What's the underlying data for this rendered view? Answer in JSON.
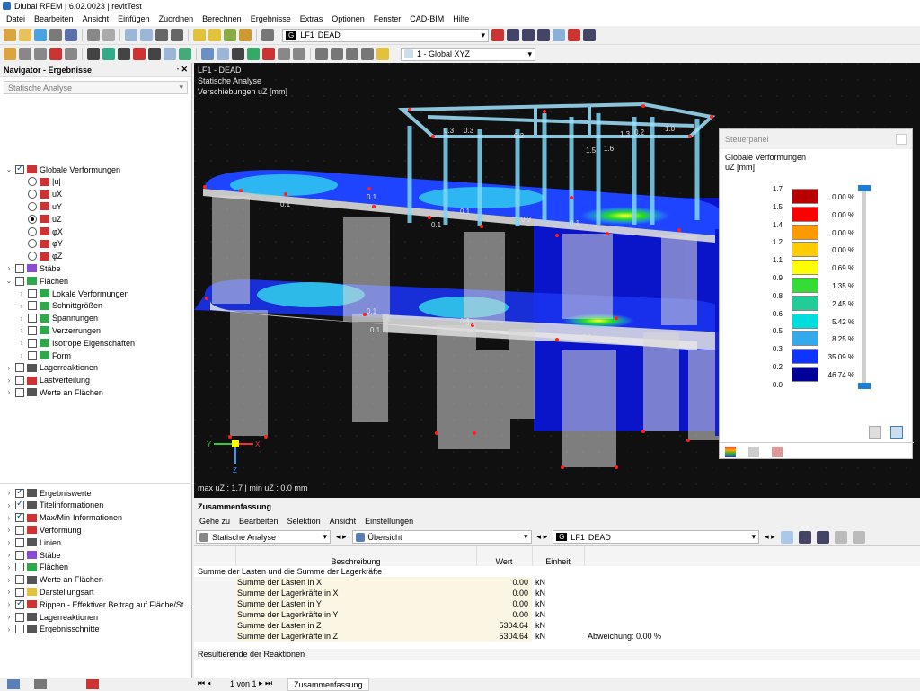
{
  "app": {
    "title": "Dlubal RFEM | 6.02.0023 | revitTest"
  },
  "menu": [
    "Datei",
    "Bearbeiten",
    "Ansicht",
    "Einfügen",
    "Zuordnen",
    "Berechnen",
    "Ergebnisse",
    "Extras",
    "Optionen",
    "Fenster",
    "CAD-BIM",
    "Hilfe"
  ],
  "toolbar": {
    "lc_g": "G",
    "lc_id": "LF1",
    "lc_name": "DEAD",
    "coord_system": "1 - Global XYZ"
  },
  "navigator": {
    "title": "Navigator - Ergebnisse",
    "analysis_select": "Statische Analyse",
    "top_items": [
      {
        "type": "check",
        "on": true,
        "expanded": true,
        "label": "Globale Verformungen",
        "icon": "deformation-icon",
        "level": 0
      },
      {
        "type": "radio",
        "on": false,
        "label": "|u|",
        "icon": "deformation-icon",
        "level": 1
      },
      {
        "type": "radio",
        "on": false,
        "label": "uX",
        "icon": "deformation-icon",
        "level": 1
      },
      {
        "type": "radio",
        "on": false,
        "label": "uY",
        "icon": "deformation-icon",
        "level": 1
      },
      {
        "type": "radio",
        "on": true,
        "label": "uZ",
        "icon": "deformation-icon",
        "level": 1
      },
      {
        "type": "radio",
        "on": false,
        "label": "φX",
        "icon": "deformation-icon",
        "level": 1
      },
      {
        "type": "radio",
        "on": false,
        "label": "φY",
        "icon": "deformation-icon",
        "level": 1
      },
      {
        "type": "radio",
        "on": false,
        "label": "φZ",
        "icon": "deformation-icon",
        "level": 1
      },
      {
        "type": "check",
        "on": false,
        "expanded": false,
        "label": "Stäbe",
        "icon": "member-icon",
        "level": 0
      },
      {
        "type": "check",
        "on": false,
        "expanded": true,
        "label": "Flächen",
        "icon": "surface-icon",
        "level": 0
      },
      {
        "type": "check",
        "on": false,
        "expanded": false,
        "label": "Lokale Verformungen",
        "icon": "surface-icon",
        "level": 1
      },
      {
        "type": "check",
        "on": false,
        "expanded": false,
        "label": "Schnittgrößen",
        "icon": "surface-icon",
        "level": 1
      },
      {
        "type": "check",
        "on": false,
        "expanded": false,
        "label": "Spannungen",
        "icon": "surface-icon",
        "level": 1
      },
      {
        "type": "check",
        "on": false,
        "expanded": false,
        "label": "Verzerrungen",
        "icon": "surface-icon",
        "level": 1
      },
      {
        "type": "check",
        "on": false,
        "expanded": false,
        "label": "Isotrope Eigenschaften",
        "icon": "surface-icon",
        "level": 1
      },
      {
        "type": "check",
        "on": false,
        "expanded": false,
        "label": "Form",
        "icon": "surface-icon",
        "level": 1
      },
      {
        "type": "check",
        "on": false,
        "expanded": false,
        "label": "Lagerreaktionen",
        "icon": "support-icon",
        "level": 0
      },
      {
        "type": "check",
        "on": false,
        "expanded": false,
        "label": "Lastverteilung",
        "icon": "load-icon",
        "level": 0
      },
      {
        "type": "check",
        "on": false,
        "expanded": false,
        "label": "Werte an Flächen",
        "icon": "values-icon",
        "level": 0
      }
    ],
    "bottom_items": [
      {
        "on": true,
        "label": "Ergebniswerte",
        "icon": "values-icon"
      },
      {
        "on": true,
        "label": "Titelinformationen",
        "icon": "title-icon"
      },
      {
        "on": true,
        "label": "Max/Min-Informationen",
        "icon": "maxmin-icon"
      },
      {
        "on": false,
        "label": "Verformung",
        "icon": "deformation-icon"
      },
      {
        "on": false,
        "label": "Linien",
        "icon": "line-icon"
      },
      {
        "on": false,
        "label": "Stäbe",
        "icon": "member-icon"
      },
      {
        "on": false,
        "label": "Flächen",
        "icon": "surface-icon"
      },
      {
        "on": false,
        "label": "Werte an Flächen",
        "icon": "values-icon"
      },
      {
        "on": false,
        "label": "Darstellungsart",
        "icon": "display-icon"
      },
      {
        "on": true,
        "label": "Rippen - Effektiver Beitrag auf Fläche/St...",
        "icon": "rib-icon"
      },
      {
        "on": false,
        "label": "Lagerreaktionen",
        "icon": "support-icon"
      },
      {
        "on": false,
        "label": "Ergebnisschnitte",
        "icon": "section-icon"
      }
    ]
  },
  "view": {
    "line1": "LF1 - DEAD",
    "line2": "Statische Analyse",
    "line3": "Verschiebungen uZ [mm]",
    "footer": "max uZ : 1.7 | min uZ : 0.0 mm",
    "labels": [
      "0.1",
      "0.1",
      "0.1",
      "0.1",
      "0.1",
      "0.3",
      "0.1",
      "0.1",
      "0.1",
      "0.1",
      "0.3",
      "0.3",
      "0.2",
      "0.2",
      "1.5",
      "1.6",
      "1.3",
      "1.0",
      "0.1"
    ],
    "axes": {
      "x": "X",
      "y": "Y",
      "z": "Z"
    }
  },
  "panel": {
    "title": "Steuerpanel",
    "subtitle": "Globale Verformungen",
    "unit": "uZ [mm]",
    "scale": [
      "1.7",
      "1.5",
      "1.4",
      "1.2",
      "1.1",
      "0.9",
      "0.8",
      "0.6",
      "0.5",
      "0.3",
      "0.2",
      "0.0"
    ],
    "colors": [
      "#b80000",
      "#ff0000",
      "#ff9900",
      "#ffcc00",
      "#ffff00",
      "#33dd33",
      "#22cc99",
      "#00dddd",
      "#33aaee",
      "#1133ff",
      "#000099"
    ],
    "percents": [
      "0.00 %",
      "0.00 %",
      "0.00 %",
      "0.00 %",
      "0.69 %",
      "1.35 %",
      "2.45 %",
      "5.42 %",
      "8.25 %",
      "35.09 %",
      "46.74 %"
    ]
  },
  "summary": {
    "title": "Zusammenfassung",
    "menu": [
      "Gehe zu",
      "Bearbeiten",
      "Selektion",
      "Ansicht",
      "Einstellungen"
    ],
    "analysis": "Statische Analyse",
    "overview": "Übersicht",
    "lc_g": "G",
    "lc_id": "LF1",
    "lc_name": "DEAD",
    "col_desc": "Beschreibung",
    "col_value": "Wert",
    "col_unit": "Einheit",
    "group1": "Summe der Lasten und die Summe der Lagerkräfte",
    "rows": [
      {
        "desc": "Summe der Lasten in X",
        "value": "0.00",
        "unit": "kN",
        "note": ""
      },
      {
        "desc": "Summe der Lagerkräfte in X",
        "value": "0.00",
        "unit": "kN",
        "note": ""
      },
      {
        "desc": "Summe der Lasten in Y",
        "value": "0.00",
        "unit": "kN",
        "note": ""
      },
      {
        "desc": "Summe der Lagerkräfte in Y",
        "value": "0.00",
        "unit": "kN",
        "note": ""
      },
      {
        "desc": "Summe der Lasten in Z",
        "value": "5304.64",
        "unit": "kN",
        "note": ""
      },
      {
        "desc": "Summe der Lagerkräfte in Z",
        "value": "5304.64",
        "unit": "kN",
        "note": "Abweichung: 0.00 %"
      }
    ],
    "group2": "Resultierende der Reaktionen",
    "pager": "1 von 1",
    "tab": "Zusammenfassung"
  }
}
